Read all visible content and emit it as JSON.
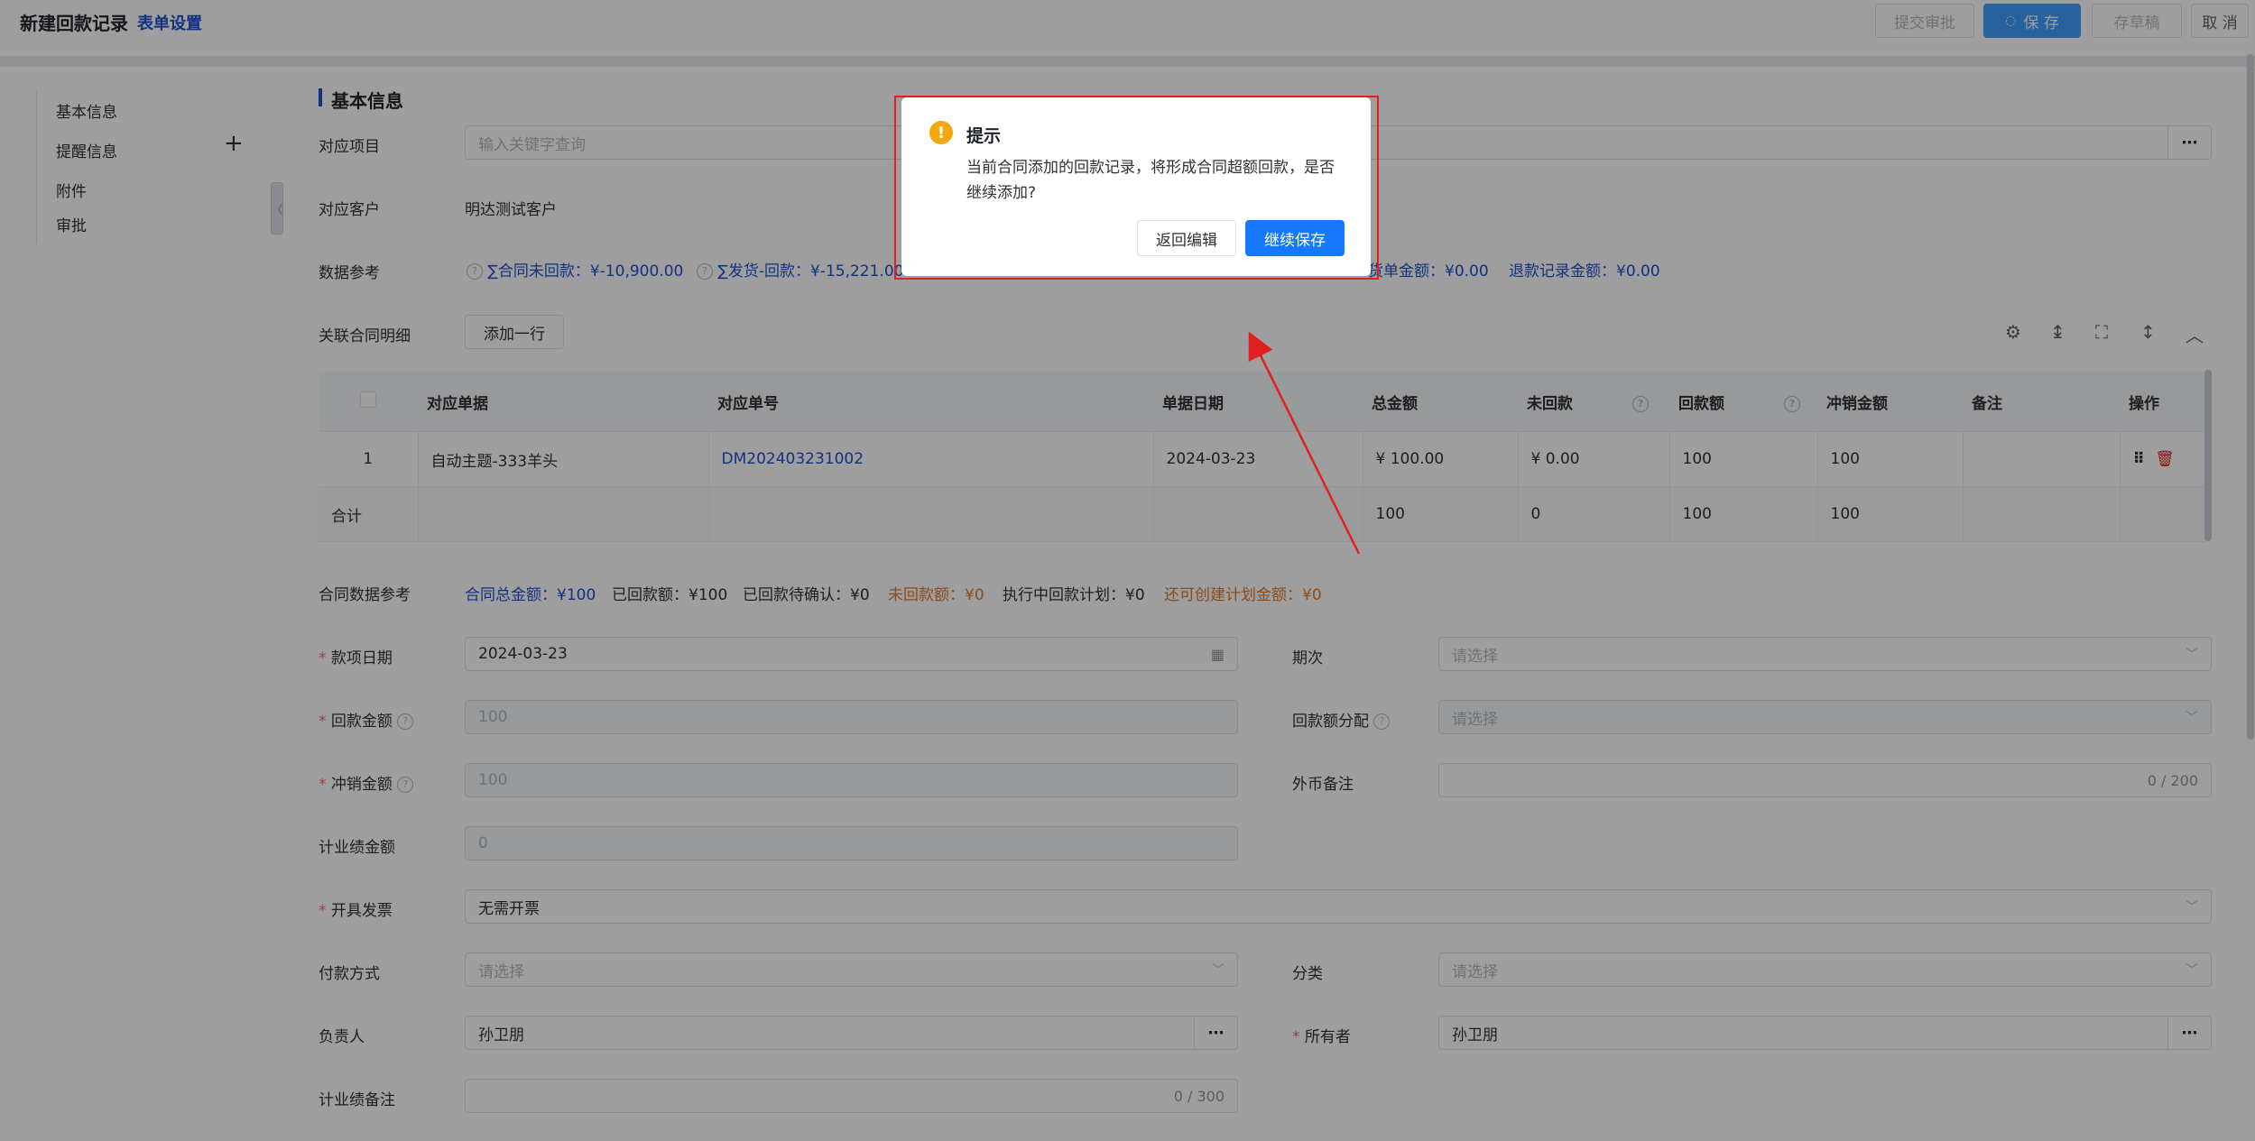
{
  "header": {
    "title": "新建回款记录",
    "form_settings": "表单设置",
    "submit_approval": "提交审批",
    "save": "保 存",
    "save_draft": "存草稿",
    "cancel": "取 消"
  },
  "sidebar": {
    "items": [
      {
        "label": "基本信息"
      },
      {
        "label": "提醒信息"
      },
      {
        "label": "附件"
      },
      {
        "label": "审批"
      }
    ],
    "add_symbol": "+"
  },
  "section": {
    "title": "基本信息"
  },
  "fields": {
    "project": {
      "label": "对应项目",
      "placeholder": "输入关键字查询"
    },
    "customer": {
      "label": "对应客户",
      "value": "明达测试客户"
    },
    "data_ref": {
      "label": "数据参考",
      "items": [
        "∑合同未回款：¥-10,900.00",
        "∑发货-回款：¥-15,221.00",
        "货单金额：¥0.00",
        "退款记录金额：¥0.00"
      ]
    },
    "contract_detail": {
      "label": "关联合同明细",
      "add_row": "添加一行"
    }
  },
  "table": {
    "headers": [
      "对应单据",
      "对应单号",
      "单据日期",
      "总金额",
      "未回款",
      "回款额",
      "冲销金额",
      "备注",
      "操作"
    ],
    "rows": [
      {
        "index": "1",
        "doc": "自动主题-333羊头",
        "number": "DM202403231002",
        "date": "2024-03-23",
        "total": "¥ 100.00",
        "unpaid": "¥ 0.00",
        "received": "100",
        "offset": "100",
        "remark": ""
      }
    ],
    "sum": {
      "label": "合计",
      "total": "100",
      "unpaid": "0",
      "received": "100",
      "offset": "100"
    }
  },
  "contract_summary": {
    "label": "合同数据参考",
    "total": "合同总金额：¥100",
    "received": "已回款额：¥100",
    "pending": "已回款待确认：¥0",
    "unreceived": "未回款额：¥0",
    "plan": "执行中回款计划：¥0",
    "creatable": "还可创建计划金额：¥0"
  },
  "form": {
    "date": {
      "label": "款项日期",
      "value": "2024-03-23"
    },
    "period": {
      "label": "期次",
      "placeholder": "请选择"
    },
    "amount": {
      "label": "回款金额",
      "value": "100"
    },
    "allocation": {
      "label": "回款额分配",
      "placeholder": "请选择"
    },
    "offset": {
      "label": "冲销金额",
      "value": "100"
    },
    "fx_note": {
      "label": "外币备注",
      "count": "0 / 200"
    },
    "perf_amount": {
      "label": "计业绩金额",
      "value": "0"
    },
    "invoice": {
      "label": "开具发票",
      "value": "无需开票"
    },
    "payment": {
      "label": "付款方式",
      "placeholder": "请选择"
    },
    "category": {
      "label": "分类",
      "placeholder": "请选择"
    },
    "owner_person": {
      "label": "负责人",
      "value": "孙卫朋"
    },
    "owner": {
      "label": "所有者",
      "value": "孙卫朋"
    },
    "perf_note": {
      "label": "计业绩备注",
      "count": "0 / 300"
    }
  },
  "dialog": {
    "title": "提示",
    "message": "当前合同添加的回款记录，将形成合同超额回款，是否继续添加?",
    "back": "返回编辑",
    "confirm": "继续保存"
  },
  "colors": {
    "primary": "#409eff",
    "link": "#1f4fcf",
    "warning": "#f6a70e",
    "danger": "#e02020",
    "orange": "#e07a2a"
  }
}
